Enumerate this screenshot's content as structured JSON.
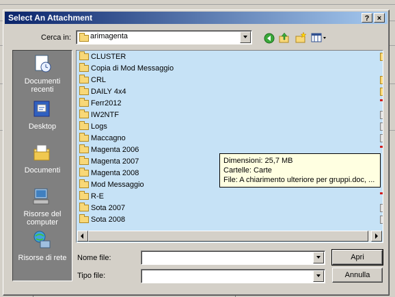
{
  "dialog": {
    "title": "Select An Attachment",
    "help_label": "?",
    "close_label": "×"
  },
  "lookin": {
    "label": "Cerca in:",
    "value": "arimagenta"
  },
  "places": [
    {
      "label": "Documenti recenti"
    },
    {
      "label": "Desktop"
    },
    {
      "label": "Documenti"
    },
    {
      "label": "Risorse del computer"
    },
    {
      "label": "Risorse di rete"
    }
  ],
  "files": [
    "CLUSTER",
    "Copia di Mod Messaggio",
    "CRL",
    "DAILY 4x4",
    "Ferr2012",
    "IW2NTF",
    "Logs",
    "Maccagno",
    "Magenta 2006",
    "Magenta 2007",
    "Magenta 2008",
    "Mod Messaggio",
    "R-E",
    "Sota 2007",
    "Sota 2008"
  ],
  "tooltip": {
    "line1": "Dimensioni: 25,7 MB",
    "line2": "Cartelle: Carte",
    "line3": "File: A chiarimento ulteriore per gruppi.doc, ..."
  },
  "filename": {
    "label": "Nome file:",
    "value": ""
  },
  "filetype": {
    "label": "Tipo file:",
    "value": ""
  },
  "buttons": {
    "open": "Apri",
    "cancel": "Annulla"
  }
}
